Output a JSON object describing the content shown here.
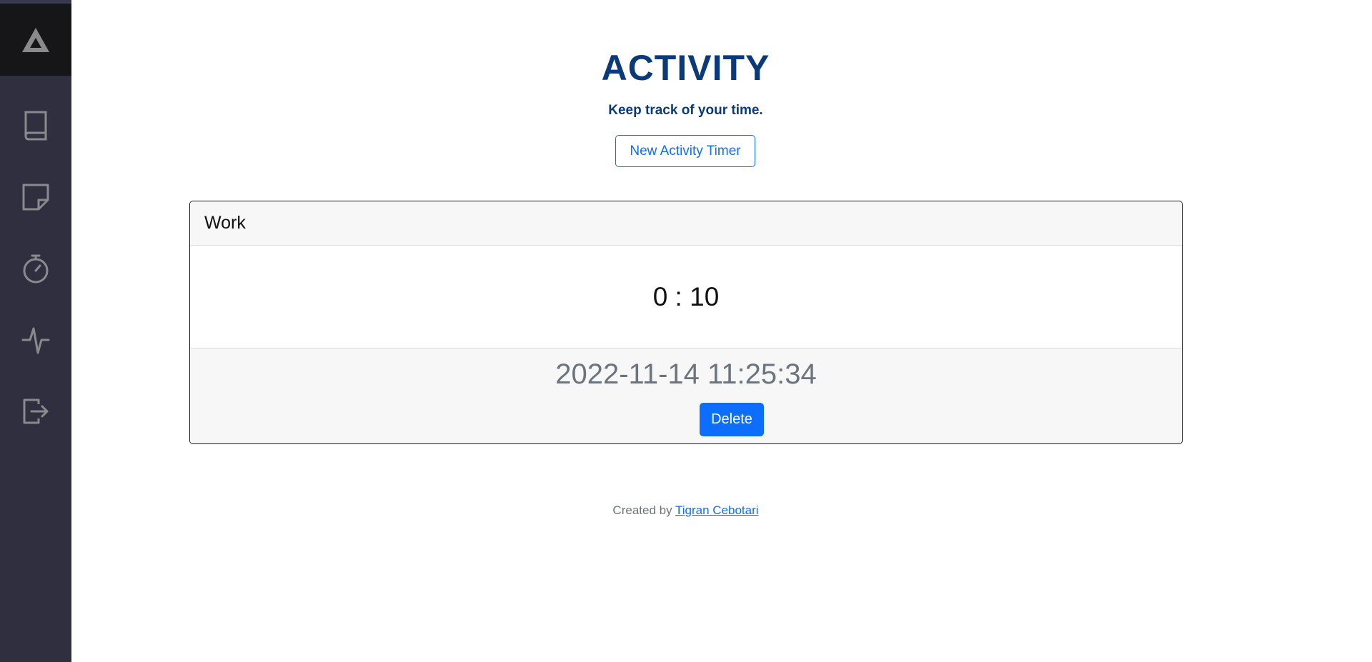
{
  "sidebar": {
    "logo_icon": "triangle-logo-icon",
    "items": [
      {
        "icon": "book-icon"
      },
      {
        "icon": "sticky-note-icon"
      },
      {
        "icon": "stopwatch-icon"
      },
      {
        "icon": "activity-pulse-icon"
      },
      {
        "icon": "sign-out-icon"
      }
    ],
    "background": "#2f2f40",
    "logo_background": "#161618",
    "icon_color": "#8a8a8e"
  },
  "header": {
    "title": "ACTIVITY",
    "subtitle": "Keep track of your time.",
    "new_button_label": "New Activity Timer"
  },
  "activity_card": {
    "name": "Work",
    "elapsed": "0 : 10",
    "started_at": "2022-11-14 11:25:34",
    "delete_label": "Delete"
  },
  "footer": {
    "prefix": "Created by",
    "author": "Tigran Cebotari"
  },
  "colors": {
    "title": "#0b3a7a",
    "primary": "#0d6efd",
    "muted": "#6c757d"
  }
}
